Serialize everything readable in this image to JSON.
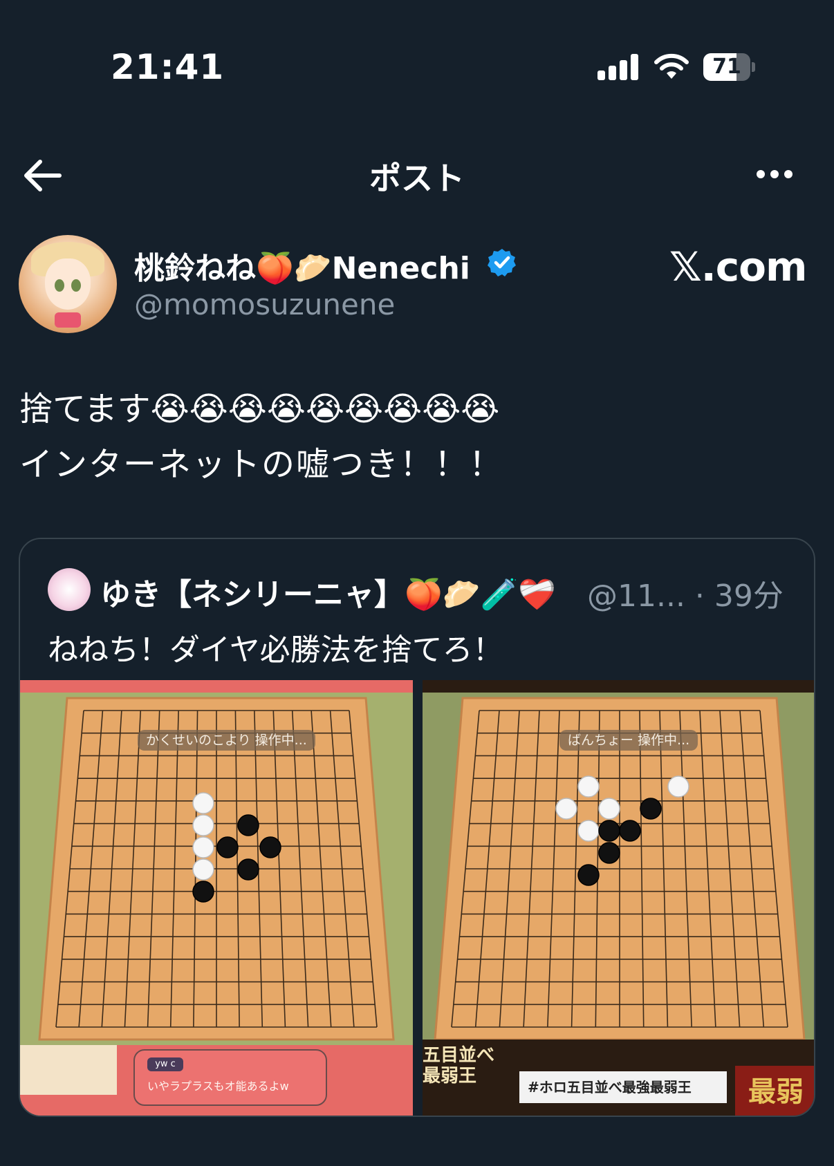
{
  "status_bar": {
    "time": "21:41",
    "battery_level": "71"
  },
  "header": {
    "title": "ポスト"
  },
  "post": {
    "display_name": "桃鈴ねね🍑🥟Nenechi",
    "handle": "@momosuzunene",
    "brand": "𝕏.com",
    "text_line1": "捨てます😭😭😭😭😭😭😭😭😭",
    "text_line2": "インターネットの嘘つき！！！"
  },
  "quote": {
    "display_name": "ゆき【ネシリーニャ】🍑🥟🧪❤️‍🩹",
    "meta": "@11... · 39分",
    "text": "ねねち！ダイヤ必勝法を捨てろ！",
    "image_left": {
      "banner": "かくせいのこより 操作中...",
      "chat_user": "yw c",
      "chat_text": "いやラプラスもオ能あるよw"
    },
    "image_right": {
      "banner": "ばんちょー 操作中...",
      "title": "五目並べ 最弱王",
      "strip_text": "#ホロ五目並べ最強最弱王",
      "red_badge": "最弱"
    }
  },
  "colors": {
    "background": "#15202b",
    "secondary_text": "#8b98a5",
    "verified_blue": "#1d9bf0",
    "border": "#38444d"
  }
}
